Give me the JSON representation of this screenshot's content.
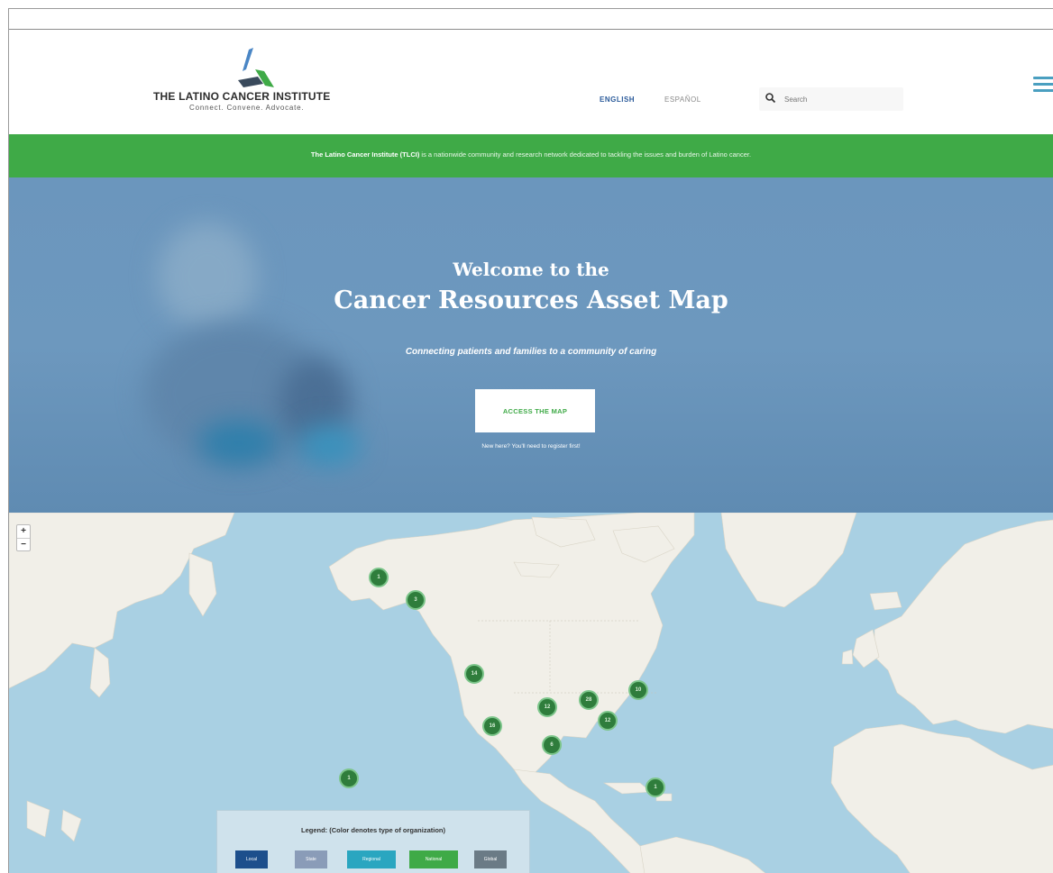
{
  "header": {
    "logo_title": "THE LATINO CANCER INSTITUTE",
    "logo_tagline": "Connect. Convene. Advocate.",
    "lang_english": "ENGLISH",
    "lang_spanish": "ESPAÑOL",
    "search_placeholder": "Search",
    "menu_icon": "hamburger-menu-icon",
    "search_icon": "search-icon"
  },
  "banner": {
    "org_name": "The Latino Cancer Institute (TLCI)",
    "text": " is a nationwide community and research network dedicated to tackling the issues and burden of Latino cancer."
  },
  "hero": {
    "welcome": "Welcome to the",
    "title": "Cancer Resources Asset Map",
    "tagline": "Connecting patients and families to a community of caring",
    "cta_label": "ACCESS THE MAP",
    "note": "New here? You'll need to register first!"
  },
  "map": {
    "zoom_in": "+",
    "zoom_out": "−",
    "markers": [
      "1",
      "3",
      "14",
      "16",
      "12",
      "28",
      "10",
      "12",
      "6",
      "1",
      "1"
    ],
    "legend_title": "Legend: (Color denotes type of organization)",
    "legend_items": [
      {
        "label": "Local",
        "color": "#1d4f8c"
      },
      {
        "label": "State",
        "color": "#8a9cb8"
      },
      {
        "label": "Regional",
        "color": "#2aa6c0"
      },
      {
        "label": "National",
        "color": "#3faa47"
      },
      {
        "label": "Global",
        "color": "#6b7b86"
      }
    ]
  },
  "colors": {
    "brand_green": "#3faa47",
    "marker_green": "#2f7d3c",
    "hero_blue": "#6b96bd",
    "ocean": "#a9d0e3",
    "land": "#f1efe8"
  }
}
